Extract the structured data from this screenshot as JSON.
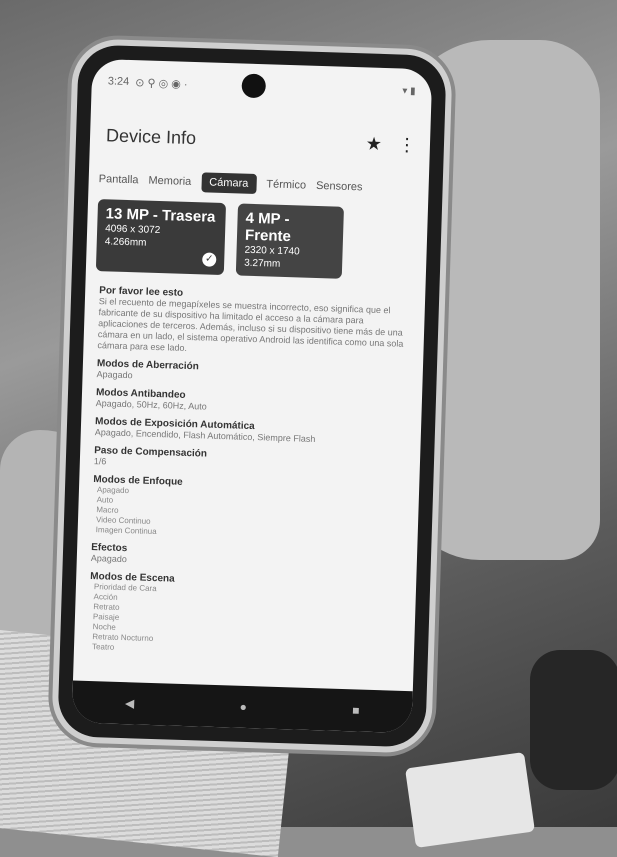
{
  "statusbar": {
    "time": "3:24"
  },
  "appbar": {
    "title": "Device Info"
  },
  "tabs": [
    {
      "label": "Pantalla"
    },
    {
      "label": "Memoria"
    },
    {
      "label": "Cámara"
    },
    {
      "label": "Térmico"
    },
    {
      "label": "Sensores"
    }
  ],
  "cards": {
    "rear": {
      "title": "13 MP - Trasera",
      "resolution": "4096 x 3072",
      "focal": "4.266mm"
    },
    "front": {
      "title": "4 MP - Frente",
      "resolution": "2320 x 1740",
      "focal": "3.27mm"
    }
  },
  "notice": {
    "title": "Por favor lee esto",
    "body": "Si el recuento de megapíxeles se muestra incorrecto, eso significa que el fabricante de su dispositivo ha limitado el acceso a la cámara para aplicaciones de terceros. Además, incluso si su dispositivo tiene más de una cámara en un lado, el sistema operativo Android las identifica como una sola cámara para ese lado."
  },
  "sections": {
    "aberration": {
      "title": "Modos de Aberración",
      "value": "Apagado"
    },
    "antibanding": {
      "title": "Modos Antibandeo",
      "value": "Apagado, 50Hz, 60Hz, Auto"
    },
    "autoexposure": {
      "title": "Modos de Exposición Automática",
      "value": "Apagado, Encendido, Flash Automático, Siempre Flash"
    },
    "compensation": {
      "title": "Paso de Compensación",
      "value": "1/6"
    },
    "focus": {
      "title": "Modos de Enfoque",
      "items": [
        "Apagado",
        "Auto",
        "Macro",
        "Video Continuo",
        "Imagen Continua"
      ]
    },
    "effects": {
      "title": "Efectos",
      "value": "Apagado"
    },
    "scene": {
      "title": "Modos de Escena",
      "items": [
        "Prioridad de Cara",
        "Acción",
        "Retrato",
        "Paisaje",
        "Noche",
        "Retrato Nocturno",
        "Teatro"
      ]
    }
  }
}
